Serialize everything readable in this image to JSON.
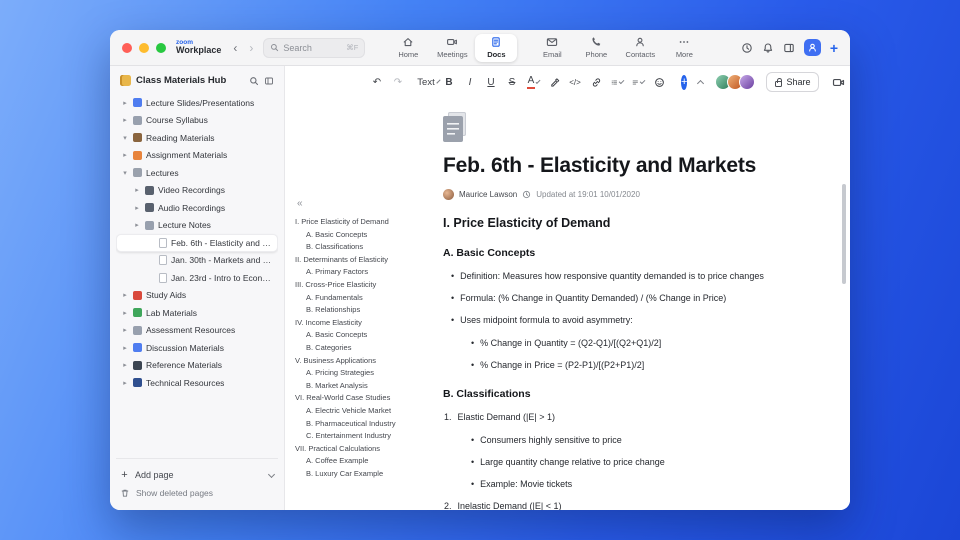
{
  "colors": {
    "accent_blue": "#2563eb",
    "desktop_gradient": [
      "#7cadfa",
      "#1b46d6"
    ],
    "titlebar_bg": "#f5f5f6",
    "sidebar_bg": "#f7f7f9",
    "selected_row_bg": "#ffffff"
  },
  "window": {
    "traffic_lights": [
      "#ff5f57",
      "#febc2e",
      "#28c840"
    ]
  },
  "titlebar": {
    "brand_zoom": "zoom",
    "brand_workplace": "Workplace",
    "back": "‹",
    "forward": "›",
    "search": {
      "placeholder": "Search",
      "shortcut": "⌘F"
    },
    "tabs": [
      {
        "label": "Home",
        "active": false
      },
      {
        "label": "Meetings",
        "active": false
      },
      {
        "label": "Docs",
        "active": true
      },
      {
        "label": "Email",
        "active": false
      },
      {
        "label": "Phone",
        "active": false
      },
      {
        "label": "Contacts",
        "active": false
      },
      {
        "label": "More",
        "active": false
      }
    ]
  },
  "sidebar": {
    "title": "Class Materials Hub",
    "items": [
      {
        "label": "Lecture Slides/Presentations",
        "depth": 0,
        "chevron": "right",
        "icon": "presentation-chart-icon",
        "icon_color": "#4f7df0"
      },
      {
        "label": "Course Syllabus",
        "depth": 0,
        "chevron": "right",
        "icon": "clipboard-icon",
        "icon_color": "#98a0ae"
      },
      {
        "label": "Reading Materials",
        "depth": 0,
        "chevron": "down",
        "icon": "open-book-icon",
        "icon_color": "#8a653f"
      },
      {
        "label": "Assignment Materials",
        "depth": 0,
        "chevron": "right",
        "icon": "notebook-icon",
        "icon_color": "#e8843c"
      },
      {
        "label": "Lectures",
        "depth": 0,
        "chevron": "down",
        "icon": "tag-icon",
        "icon_color": "#9aa1ad"
      },
      {
        "label": "Video Recordings",
        "depth": 1,
        "chevron": "right",
        "icon": "video-camera-icon",
        "icon_color": "#59616e"
      },
      {
        "label": "Audio Recordings",
        "depth": 1,
        "chevron": "right",
        "icon": "headphones-icon",
        "icon_color": "#59616e"
      },
      {
        "label": "Lecture Notes",
        "depth": 1,
        "chevron": "right",
        "icon": "document-icon",
        "icon_color": "#98a0ae"
      },
      {
        "label": "Feb. 6th - Elasticity and M...",
        "depth": 2,
        "kind": "page",
        "icon": "page-icon",
        "selected": true
      },
      {
        "label": "Jan. 30th - Markets and P...",
        "depth": 2,
        "kind": "page",
        "icon": "page-icon"
      },
      {
        "label": "Jan. 23rd - Intro to Econo...",
        "depth": 2,
        "kind": "page",
        "icon": "page-icon"
      },
      {
        "label": "Study Aids",
        "depth": 0,
        "chevron": "right",
        "icon": "apple-icon",
        "icon_color": "#d9493c"
      },
      {
        "label": "Lab Materials",
        "depth": 0,
        "chevron": "right",
        "icon": "flask-icon",
        "icon_color": "#3fa65b"
      },
      {
        "label": "Assessment Resources",
        "depth": 0,
        "chevron": "right",
        "icon": "ruler-icon",
        "icon_color": "#98a0ae"
      },
      {
        "label": "Discussion Materials",
        "depth": 0,
        "chevron": "right",
        "icon": "chat-bubble-icon",
        "icon_color": "#4f7df0"
      },
      {
        "label": "Reference Materials",
        "depth": 0,
        "chevron": "right",
        "icon": "bookmark-icon",
        "icon_color": "#3c4552"
      },
      {
        "label": "Technical Resources",
        "depth": 0,
        "chevron": "right",
        "icon": "book-icon",
        "icon_color": "#2f4f8f"
      }
    ],
    "footer": {
      "add_page": "Add page",
      "show_deleted": "Show deleted pages"
    }
  },
  "toolbar": {
    "undo": "↶",
    "redo": "↷",
    "text_style": "Text",
    "bold": "B",
    "italic": "I",
    "underline": "U",
    "strike": "S",
    "font_color": "A",
    "code": "</>",
    "share": "Share",
    "more": "···",
    "collaborators": [
      [
        "#8fd0b2",
        "#2f7d5a"
      ],
      [
        "#f0b27a",
        "#c05621"
      ],
      [
        "#c6a9e8",
        "#6b3fa0"
      ]
    ]
  },
  "doc": {
    "title": "Feb. 6th - Elasticity and Markets",
    "author": "Maurice Lawson",
    "updated": "Updated at 19:01 10/01/2020",
    "outline_collapse": "«",
    "outline": [
      {
        "label": "I. Price Elasticity of Demand",
        "depth": 0
      },
      {
        "label": "A. Basic Concepts",
        "depth": 1
      },
      {
        "label": "B. Classifications",
        "depth": 1
      },
      {
        "label": "II. Determinants of Elasticity",
        "depth": 0
      },
      {
        "label": "A. Primary Factors",
        "depth": 1
      },
      {
        "label": "III. Cross-Price Elasticity",
        "depth": 0
      },
      {
        "label": "A. Fundamentals",
        "depth": 1
      },
      {
        "label": "B. Relationships",
        "depth": 1
      },
      {
        "label": "IV. Income Elasticity",
        "depth": 0
      },
      {
        "label": "A. Basic Concepts",
        "depth": 1
      },
      {
        "label": "B. Categories",
        "depth": 1
      },
      {
        "label": "V. Business Applications",
        "depth": 0
      },
      {
        "label": "A. Pricing Strategies",
        "depth": 1
      },
      {
        "label": "B. Market Analysis",
        "depth": 1
      },
      {
        "label": "VI. Real-World Case Studies",
        "depth": 0
      },
      {
        "label": "A. Electric Vehicle Market",
        "depth": 1
      },
      {
        "label": "B. Pharmaceutical Industry",
        "depth": 1
      },
      {
        "label": "C. Entertainment Industry",
        "depth": 1
      },
      {
        "label": "VII. Practical Calculations",
        "depth": 0
      },
      {
        "label": "A. Coffee Example",
        "depth": 1
      },
      {
        "label": "B. Luxury Car Example",
        "depth": 1
      }
    ],
    "content": [
      {
        "type": "h2",
        "text": "I. Price Elasticity of Demand"
      },
      {
        "type": "h3",
        "text": "A. Basic Concepts"
      },
      {
        "type": "bullet",
        "depth": 1,
        "text": "Definition: Measures how responsive quantity demanded is to price changes"
      },
      {
        "type": "bullet",
        "depth": 1,
        "text": "Formula: (% Change in Quantity Demanded) / (% Change in Price)"
      },
      {
        "type": "bullet",
        "depth": 1,
        "text": "Uses midpoint formula to avoid asymmetry:"
      },
      {
        "type": "bullet",
        "depth": 2,
        "text": "% Change in Quantity = (Q2-Q1)/[(Q2+Q1)/2]"
      },
      {
        "type": "bullet",
        "depth": 2,
        "text": "% Change in Price = (P2-P1)/[(P2+P1)/2]"
      },
      {
        "type": "h3",
        "text": "B. Classifications"
      },
      {
        "type": "number",
        "marker": "1.",
        "text": "Elastic Demand (|E| > 1)"
      },
      {
        "type": "bullet",
        "depth": 2,
        "text": "Consumers highly sensitive to price"
      },
      {
        "type": "bullet",
        "depth": 2,
        "text": "Large quantity change relative to price change"
      },
      {
        "type": "bullet",
        "depth": 2,
        "text": "Example: Movie tickets"
      },
      {
        "type": "number",
        "marker": "2.",
        "text": "Inelastic Demand (|E| < 1)"
      }
    ]
  }
}
